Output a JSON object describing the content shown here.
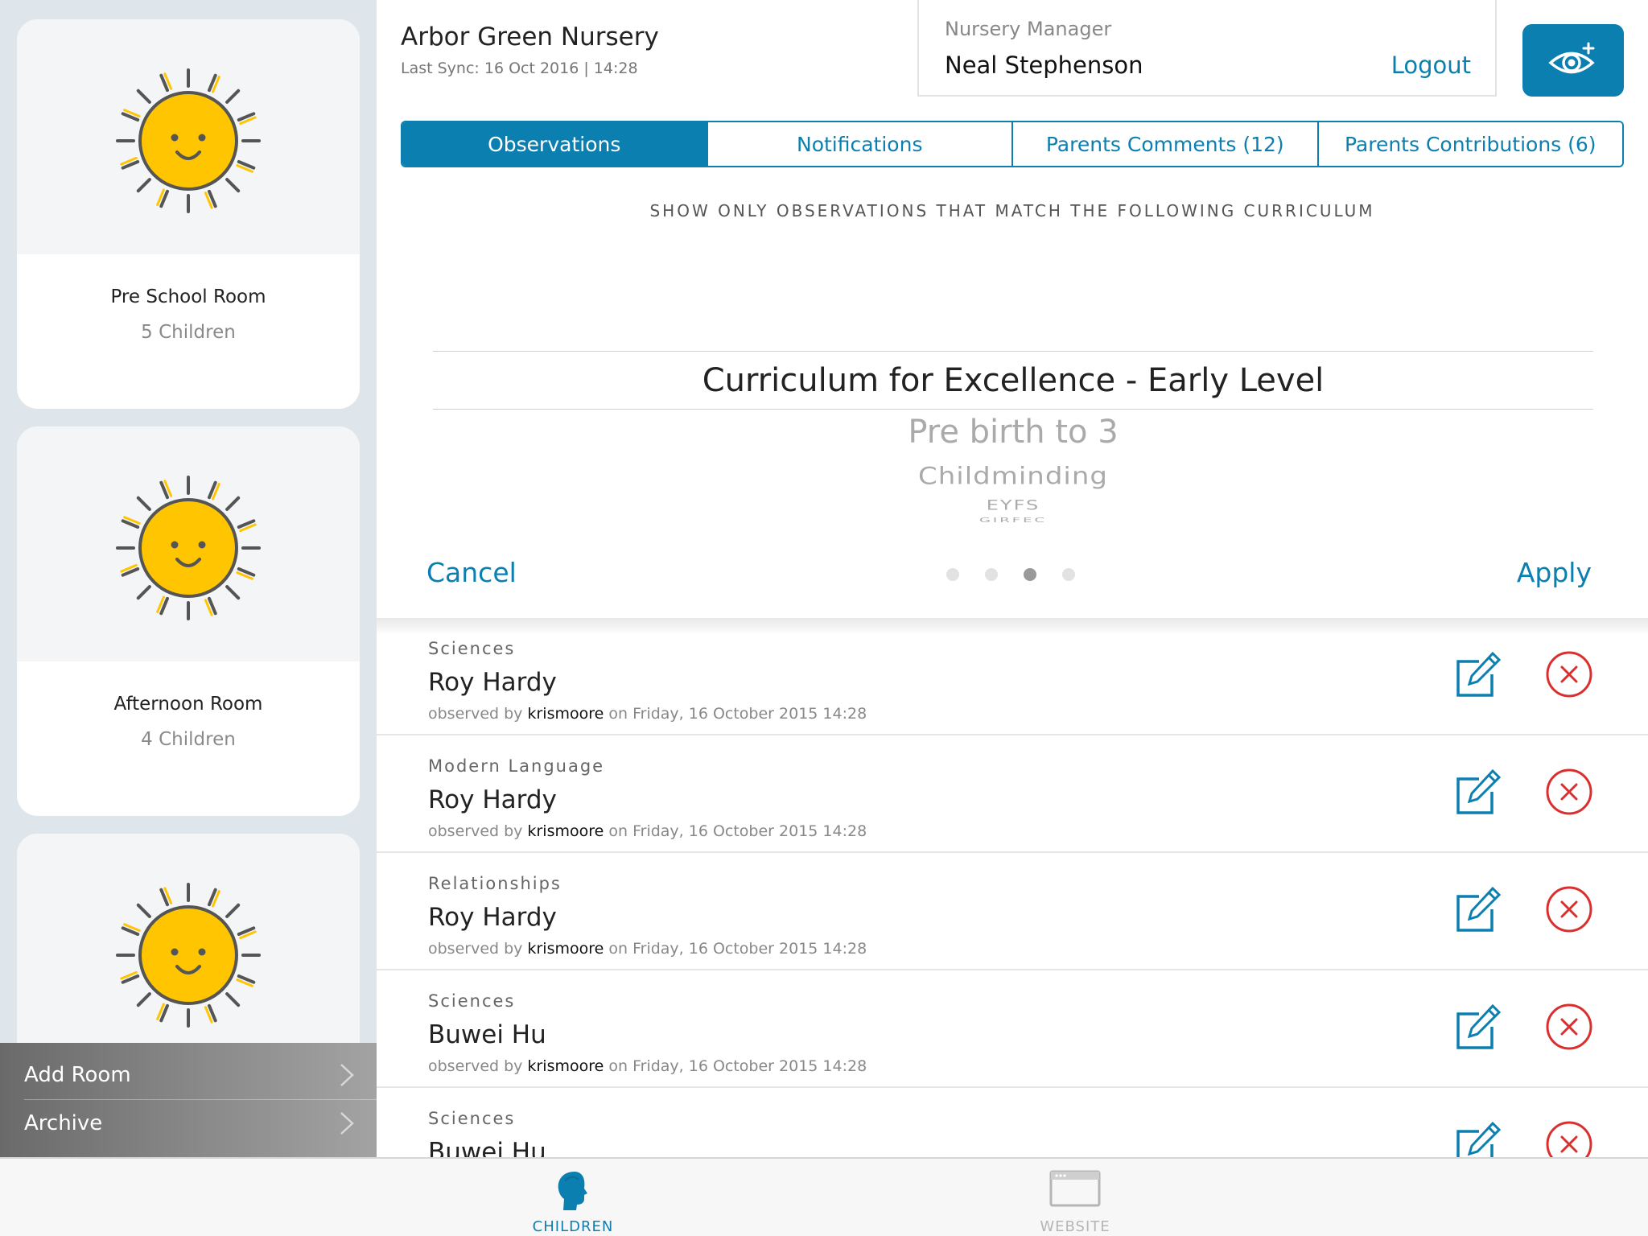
{
  "colors": {
    "accent": "#0b7fb0",
    "danger": "#d9302f",
    "sun": "#fec500"
  },
  "sidebar": {
    "rooms": [
      {
        "name": "Pre School Room",
        "count": "5 Children",
        "icon": "sun-icon"
      },
      {
        "name": "Afternoon Room",
        "count": "4 Children",
        "icon": "sun-icon"
      },
      {
        "name": "",
        "count": "",
        "icon": "sun-icon"
      }
    ],
    "menu": [
      {
        "label": "Add Room"
      },
      {
        "label": "Archive"
      }
    ]
  },
  "header": {
    "nursery_name": "Arbor Green Nursery",
    "last_sync": "Last Sync: 16 Oct 2016 | 14:28",
    "manager_role": "Nursery Manager",
    "manager_name": "Neal Stephenson",
    "logout_label": "Logout",
    "eye_button_icon": "eye-plus-icon"
  },
  "tabs": [
    {
      "label": "Observations",
      "active": true
    },
    {
      "label": "Notifications",
      "active": false
    },
    {
      "label": "Parents Comments (12)",
      "active": false
    },
    {
      "label": "Parents Contributions (6)",
      "active": false
    }
  ],
  "filter": {
    "heading": "SHOW ONLY OBSERVATIONS THAT MATCH THE FOLLOWING CURRICULUM",
    "options": [
      "Curriculum for Excellence - Early Level",
      "Pre birth to 3",
      "Childminding",
      "EYFS",
      "GIRFEC"
    ],
    "selected": "Curriculum for Excellence - Early Level",
    "cancel_label": "Cancel",
    "apply_label": "Apply",
    "page_dots": {
      "count": 4,
      "active_index": 2
    }
  },
  "observations": [
    {
      "category": "Sciences",
      "child": "Roy Hardy",
      "prefix": "observed by",
      "observer": "krismoore",
      "date": "on Friday, 16 October 2015 14:28"
    },
    {
      "category": "Modern Language",
      "child": "Roy Hardy",
      "prefix": "observed by",
      "observer": "krismoore",
      "date": "on Friday, 16 October 2015 14:28"
    },
    {
      "category": "Relationships",
      "child": "Roy Hardy",
      "prefix": "observed by",
      "observer": "krismoore",
      "date": "on Friday, 16 October 2015 14:28"
    },
    {
      "category": "Sciences",
      "child": "Buwei Hu",
      "prefix": "observed by",
      "observer": "krismoore",
      "date": "on Friday, 16 October 2015 14:28"
    },
    {
      "category": "Sciences",
      "child": "Buwei Hu",
      "prefix": "",
      "observer": "",
      "date": ""
    }
  ],
  "bottom_tabs": [
    {
      "label": "CHILDREN",
      "icon": "child-head-icon",
      "active": true
    },
    {
      "label": "WEBSITE",
      "icon": "browser-window-icon",
      "active": false
    }
  ]
}
